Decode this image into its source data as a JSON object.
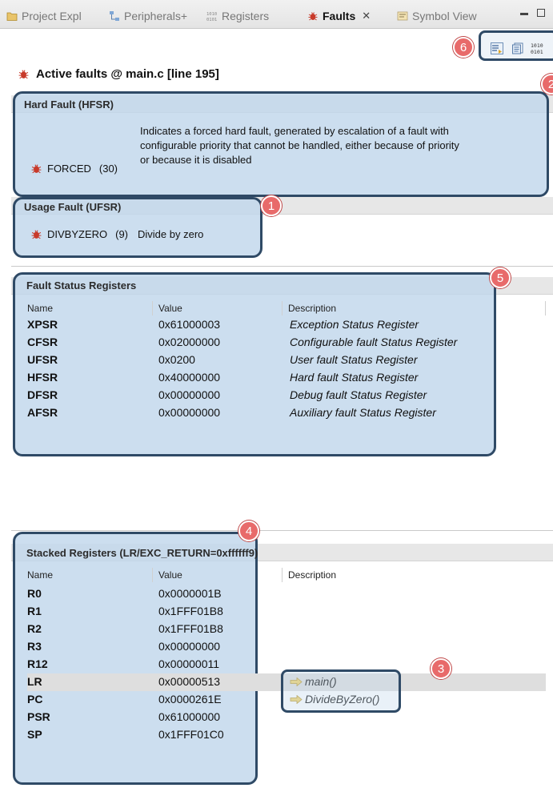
{
  "tabs": [
    {
      "label": "Project Expl",
      "icon": "folder-icon"
    },
    {
      "label": "Peripherals+",
      "icon": "peripherals-icon"
    },
    {
      "label": "Registers",
      "icon": "registers-binary-icon"
    },
    {
      "label": "Faults",
      "icon": "bug-icon",
      "active": true
    },
    {
      "label": "Symbol View",
      "icon": "symbol-view-icon"
    }
  ],
  "toolbar": {
    "icons": [
      "show-details-icon",
      "copy-icon",
      "binary-format-icon"
    ]
  },
  "header": {
    "title": "Active faults @ main.c [line 195]"
  },
  "hard_fault": {
    "title": "Hard Fault (HFSR)",
    "name": "FORCED",
    "code": "(30)",
    "desc_lines": [
      "Indicates a forced hard fault, generated by escalation of a fault with",
      "configurable priority that cannot be handled, either because of priority",
      "or because it is disabled"
    ]
  },
  "usage_fault": {
    "title": "Usage Fault (UFSR)",
    "name": "DIVBYZERO",
    "code": "(9)",
    "desc": "Divide by zero"
  },
  "fault_status": {
    "title": "Fault Status Registers",
    "columns": [
      "Name",
      "Value",
      "Description"
    ],
    "rows": [
      {
        "name": "XPSR",
        "value": "0x61000003",
        "desc": "Exception Status Register"
      },
      {
        "name": "CFSR",
        "value": "0x02000000",
        "desc": "Configurable fault Status Register"
      },
      {
        "name": "UFSR",
        "value": "0x0200",
        "desc": "User fault Status Register"
      },
      {
        "name": "HFSR",
        "value": "0x40000000",
        "desc": "Hard fault Status Register"
      },
      {
        "name": "DFSR",
        "value": "0x00000000",
        "desc": "Debug fault Status Register"
      },
      {
        "name": "AFSR",
        "value": "0x00000000",
        "desc": "Auxiliary fault Status Register"
      }
    ]
  },
  "stacked": {
    "title": "Stacked Registers (LR/EXC_RETURN=0xffffff9)",
    "columns": [
      "Name",
      "Value",
      "Description"
    ],
    "rows": [
      {
        "name": "R0",
        "value": "0x0000001B",
        "desc": ""
      },
      {
        "name": "R1",
        "value": "0x1FFF01B8",
        "desc": ""
      },
      {
        "name": "R2",
        "value": "0x1FFF01B8",
        "desc": ""
      },
      {
        "name": "R3",
        "value": "0x00000000",
        "desc": ""
      },
      {
        "name": "R12",
        "value": "0x00000011",
        "desc": ""
      },
      {
        "name": "LR",
        "value": "0x00000513",
        "desc": "main()"
      },
      {
        "name": "PC",
        "value": "0x0000261E",
        "desc": "DivideByZero()"
      },
      {
        "name": "PSR",
        "value": "0x61000000",
        "desc": ""
      },
      {
        "name": "SP",
        "value": "0x1FFF01C0",
        "desc": ""
      }
    ]
  },
  "callouts": [
    "1",
    "2",
    "3",
    "4",
    "5",
    "6"
  ],
  "colors": {
    "callout_fill": "#e86a6a",
    "highlight_fill": "#c1d7eb",
    "highlight_border": "#2f4a66",
    "bug_red": "#c83a2a"
  }
}
